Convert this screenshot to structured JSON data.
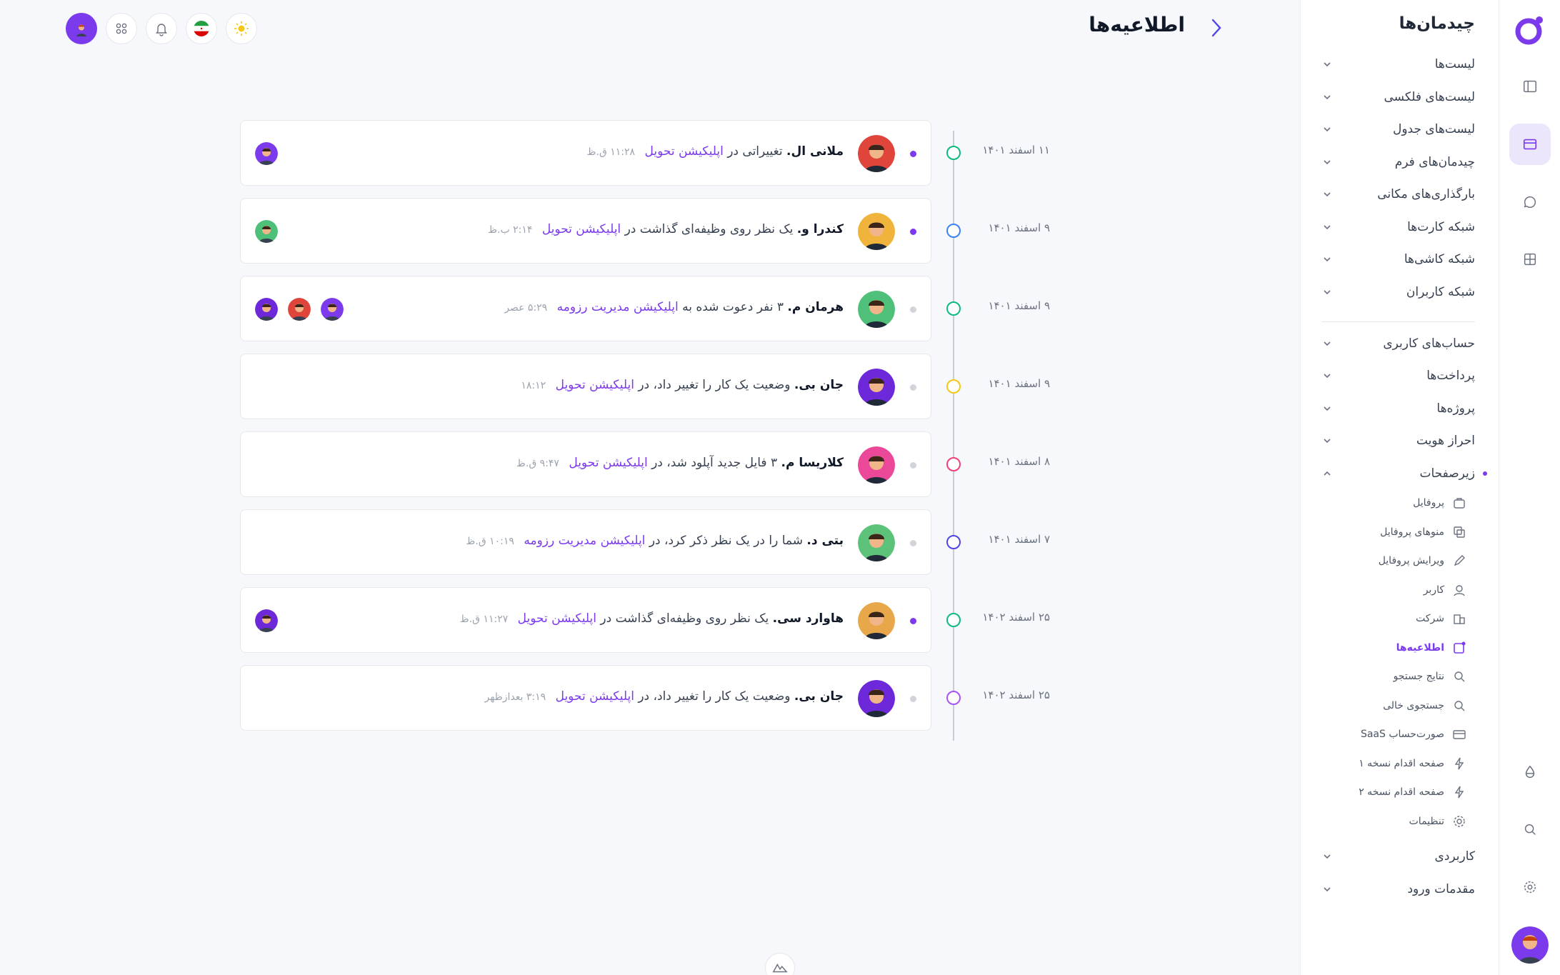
{
  "header": {
    "title": "اطلاعیه‌ها"
  },
  "sidebar": {
    "title": "چیدمان‌ها",
    "groups": [
      {
        "label": "لیست‌ها"
      },
      {
        "label": "لیست‌های فلکسی"
      },
      {
        "label": "لیست‌های جدول"
      },
      {
        "label": "چیدمان‌های فرم"
      },
      {
        "label": "بارگذاری‌های مکانی"
      },
      {
        "label": "شبکه کارت‌ها"
      },
      {
        "label": "شبکه کاشی‌ها"
      },
      {
        "label": "شبکه کاربران"
      }
    ],
    "groups2": [
      {
        "label": "حساب‌های کاربری"
      },
      {
        "label": "پرداخت‌ها"
      },
      {
        "label": "پروژه‌ها"
      },
      {
        "label": "احراز هویت"
      },
      {
        "label": "زیرصفحات"
      }
    ],
    "subpages": [
      {
        "label": "پروفایل",
        "icon": "briefcase-icon"
      },
      {
        "label": "منوهای پروفایل",
        "icon": "copy-icon"
      },
      {
        "label": "ویرایش پروفایل",
        "icon": "pencil-icon"
      },
      {
        "label": "کاربر",
        "icon": "user-icon"
      },
      {
        "label": "شرکت",
        "icon": "building-icon"
      },
      {
        "label": "اطلاعیه‌ها",
        "icon": "notification-icon",
        "active": true
      },
      {
        "label": "نتایج جستجو",
        "icon": "search-icon"
      },
      {
        "label": "جستجوی خالی",
        "icon": "search-icon"
      },
      {
        "label": "صورت‌حساب SaaS",
        "icon": "credit-card-icon"
      },
      {
        "label": "صفحه اقدام نسخه ۱",
        "icon": "lightning-icon"
      },
      {
        "label": "صفحه اقدام نسخه ۲",
        "icon": "lightning-icon"
      },
      {
        "label": "تنظیمات",
        "icon": "gear-icon"
      }
    ],
    "groups3": [
      {
        "label": "کاربردی"
      },
      {
        "label": "مقدمات ورود"
      }
    ]
  },
  "colors": {
    "accent": "#7c3aed",
    "green": "#10b981",
    "blue": "#3b82f6",
    "yellow": "#f5c518",
    "pink": "#f0417a",
    "indigo": "#4f46e5",
    "purple": "#a855f7"
  },
  "notifications": [
    {
      "name": "ملانی ال.",
      "action": "تغییراتی در",
      "project": "اپلیکیشن تحویل",
      "time": "۱۱:۲۸ ق.ظ",
      "date": "۱۱ اسفند ۱۴۰۱",
      "unread": true,
      "node_color": "#10b981",
      "avatar_bg": "#e0453c",
      "people": 1
    },
    {
      "name": "کندرا و.",
      "action": "یک نظر روی وظیفه‌ای گذاشت در",
      "project": "اپلیکیشن تحویل",
      "time": "۲:۱۴ ب.ظ",
      "date": "۹ اسفند ۱۴۰۱",
      "unread": true,
      "node_color": "#3b82f6",
      "avatar_bg": "#f0b43c",
      "people": 1
    },
    {
      "name": "هرمان م.",
      "action": "۳ نفر دعوت شده به",
      "project": "اپلیکیشن مدیریت رزومه",
      "time": "۵:۲۹ عصر",
      "date": "۹ اسفند ۱۴۰۱",
      "unread": false,
      "node_color": "#10b981",
      "avatar_bg": "#4fc07a",
      "people": 3
    },
    {
      "name": "جان بی.",
      "action": "وضعیت یک کار را تغییر داد، در",
      "project": "اپلیکیشن تحویل",
      "time": "۱۸:۱۲",
      "date": "۹ اسفند ۱۴۰۱",
      "unread": false,
      "node_color": "#f5c518",
      "avatar_bg": "#6d28d9",
      "people": 0
    },
    {
      "name": "کلاریسا م.",
      "action": "۳ فایل جدید آپلود شد، در",
      "project": "اپلیکیشن تحویل",
      "time": "۹:۴۷ ق.ظ",
      "date": "۸ اسفند ۱۴۰۱",
      "unread": false,
      "node_color": "#f0417a",
      "avatar_bg": "#ec4899",
      "people": 0
    },
    {
      "name": "بتی د.",
      "action": "شما را در یک نظر ذکر کرد، در",
      "project": "اپلیکیشن مدیریت رزومه",
      "time": "۱۰:۱۹ ق.ظ",
      "date": "۷ اسفند ۱۴۰۱",
      "unread": false,
      "node_color": "#4f46e5",
      "avatar_bg": "#5cc27a",
      "people": 0
    },
    {
      "name": "هاوارد سی.",
      "action": "یک نظر روی وظیفه‌ای گذاشت در",
      "project": "اپلیکیشن تحویل",
      "time": "۱۱:۲۷ ق.ظ",
      "date": "۲۵ اسفند ۱۴۰۲",
      "unread": true,
      "node_color": "#10b981",
      "avatar_bg": "#e8a84a",
      "people": 1
    },
    {
      "name": "جان بی.",
      "action": "وضعیت یک کار را تغییر داد، در",
      "project": "اپلیکیشن تحویل",
      "time": "۳:۱۹ بعدازظهر",
      "date": "۲۵ اسفند ۱۴۰۲",
      "unread": false,
      "node_color": "#a855f7",
      "avatar_bg": "#6d28d9",
      "people": 0
    }
  ]
}
